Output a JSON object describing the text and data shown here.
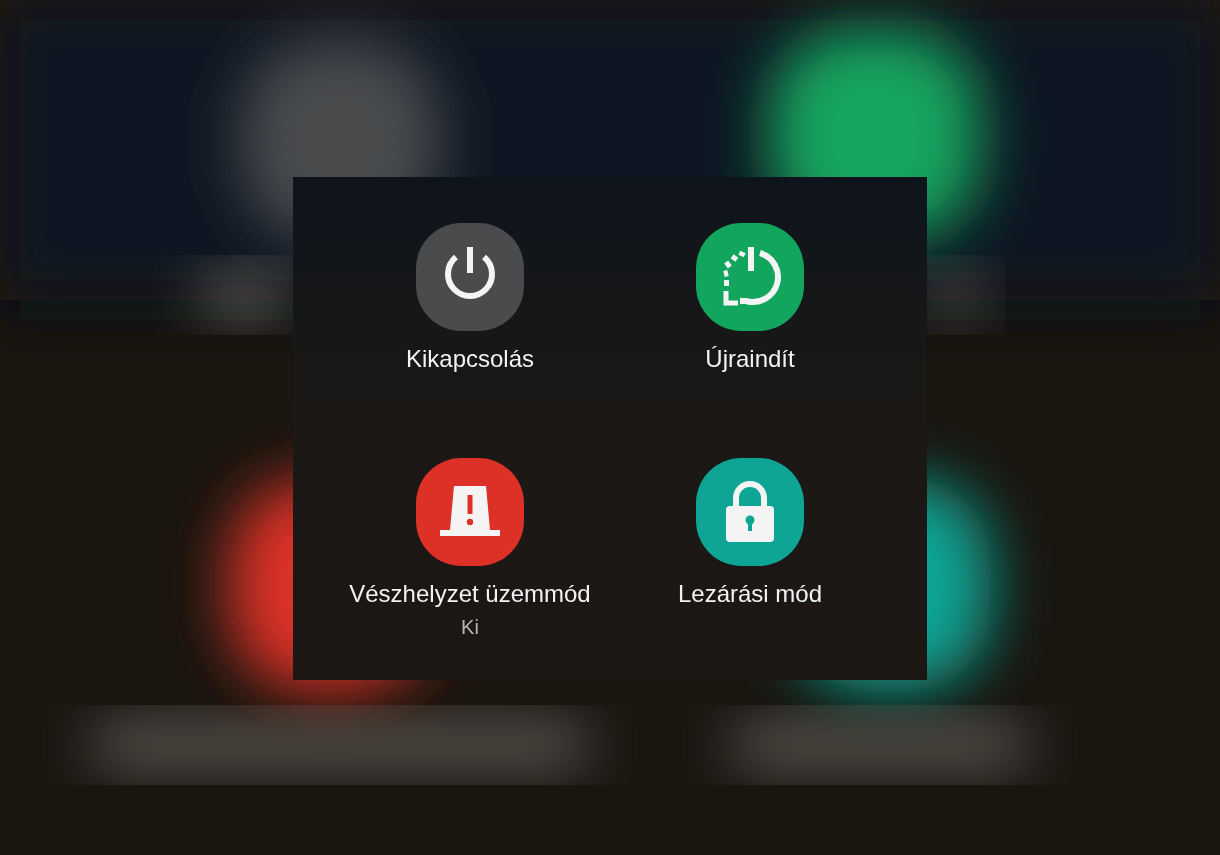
{
  "actions": [
    {
      "kind": "power",
      "label": "Kikapcsolás",
      "color": "#4a4b4d"
    },
    {
      "kind": "restart",
      "label": "Újraindít",
      "color": "#12a55e"
    },
    {
      "kind": "emergency",
      "label": "Vészhelyzet üzemmód",
      "status": "Ki",
      "color": "#dd3127"
    },
    {
      "kind": "lock",
      "label": "Lezárási mód",
      "color": "#0fa594"
    }
  ]
}
